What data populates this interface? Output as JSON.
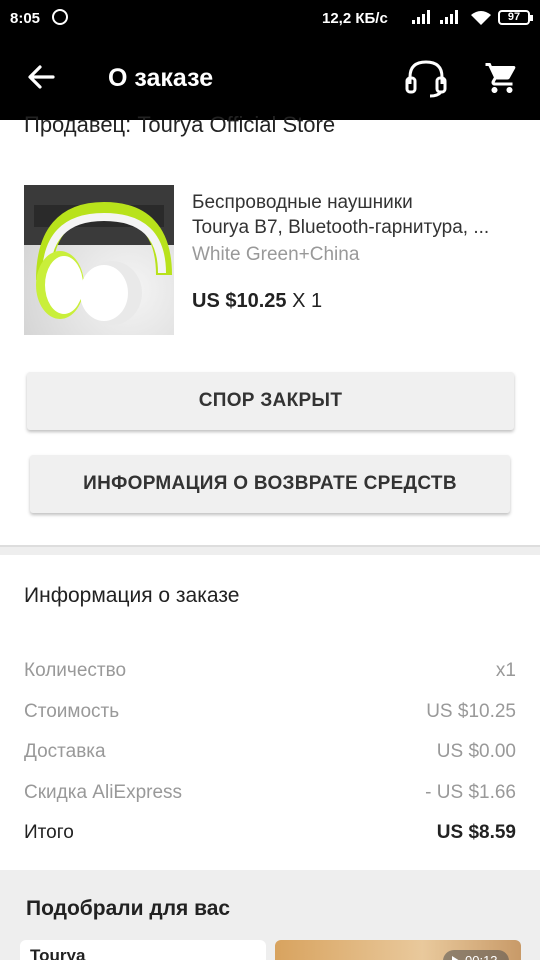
{
  "status_bar": {
    "time": "8:05",
    "network_speed": "12,2 КБ/с",
    "battery": "97"
  },
  "header": {
    "title": "О заказе"
  },
  "seller": {
    "text": "Продавец: Tourya Official Store"
  },
  "product": {
    "name_line1": "Беспроводные наушники",
    "name_line2": "Tourya B7, Bluetooth-гарнитура, ...",
    "variant": "White Green+China",
    "price": "US $10.25",
    "quantity": "X 1"
  },
  "actions": {
    "dispute_label": "СПОР ЗАКРЫТ",
    "refund_label": "ИНФОРМАЦИЯ О ВОЗВРАТЕ СРЕДСТВ"
  },
  "order_info": {
    "title": "Информация о заказе",
    "rows": [
      {
        "label": "Количество",
        "value": "x1"
      },
      {
        "label": "Стоимость",
        "value": "US $10.25"
      },
      {
        "label": "Доставка",
        "value": "US $0.00"
      },
      {
        "label": "Скидка AliExpress",
        "value": "- US $1.66"
      },
      {
        "label": "Итого",
        "value": "US $8.59"
      }
    ]
  },
  "recommendations": {
    "title": "Подобрали для вас",
    "card1_title": "Tourya",
    "card2_video_time": "00:13"
  },
  "colors": {
    "header_bg": "#000000",
    "page_bg": "#ffffff",
    "section_bg": "#eeeeee",
    "button_bg": "#f0f0f0",
    "muted_text": "#999999"
  },
  "icons": {
    "back": "arrow-left-icon",
    "support": "headset-icon",
    "cart": "shopping-cart-icon",
    "alarm": "alarm-icon",
    "signal": "signal-icon",
    "wifi": "wifi-icon",
    "battery": "battery-icon",
    "play": "play-icon"
  }
}
